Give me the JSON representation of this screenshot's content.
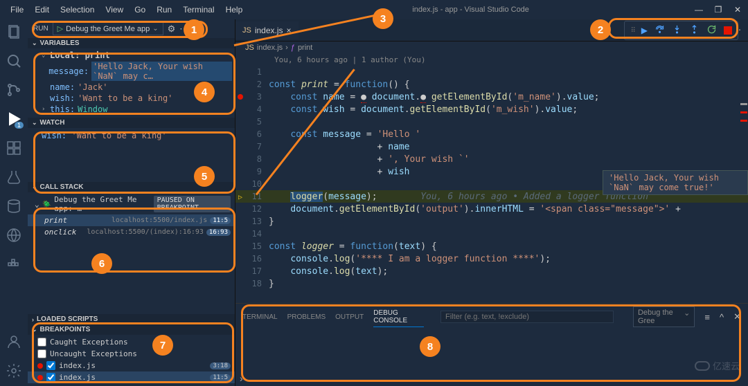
{
  "menus": [
    "File",
    "Edit",
    "Selection",
    "View",
    "Go",
    "Run",
    "Terminal",
    "Help"
  ],
  "window_title": "index.js - app - Visual Studio Code",
  "run": {
    "label": "RUN",
    "config": "Debug the Greet Me app"
  },
  "debug_badge": "1",
  "sections": {
    "variables": "Variables",
    "watch": "Watch",
    "callstack": "Call Stack",
    "loaded": "Loaded Scripts",
    "breakpoints": "Breakpoints"
  },
  "variables": {
    "scope": "Local: print",
    "items": [
      {
        "key": "message:",
        "val": "'Hello Jack, Your wish `NaN` may c…",
        "hl": true
      },
      {
        "key": "name:",
        "val": "'Jack'"
      },
      {
        "key": "wish:",
        "val": "'Want to be a king'"
      }
    ],
    "this": {
      "key": "this:",
      "val": "Window"
    }
  },
  "watch": [
    {
      "key": "wish:",
      "val": "'Want to be a king'"
    }
  ],
  "callstack": {
    "session": "Debug the Greet Me app: …",
    "status": "PAUSED ON BREAKPOINT",
    "frames": [
      {
        "fn": "print",
        "loc": "localhost:5500/index.js",
        "ln": "11:5"
      },
      {
        "fn": "onclick",
        "loc": "localhost:5500/(index):16:93",
        "ln": "16:93"
      }
    ]
  },
  "breakpoints": {
    "caught": "Caught Exceptions",
    "uncaught": "Uncaught Exceptions",
    "items": [
      {
        "label": "index.js",
        "ln": "3:18"
      },
      {
        "label": "index.js",
        "ln": "11:5"
      }
    ]
  },
  "tab": {
    "name": "index.js"
  },
  "crumbs": {
    "file": "index.js",
    "sym": "print"
  },
  "codelens": "You, 6 hours ago | 1 author (You)",
  "hover": "'Hello Jack, Your wish `NaN` may come true!'",
  "ghost_annotation": "You, 6 hours ago • Added a logger function",
  "panel": {
    "tabs": [
      "Terminal",
      "Problems",
      "Output",
      "Debug Console"
    ],
    "filter_placeholder": "Filter (e.g. text, !exclude)",
    "scope": "Debug the Gree"
  },
  "watermark": "亿速云",
  "callouts": [
    "1",
    "2",
    "3",
    "4",
    "5",
    "6",
    "7",
    "8"
  ]
}
